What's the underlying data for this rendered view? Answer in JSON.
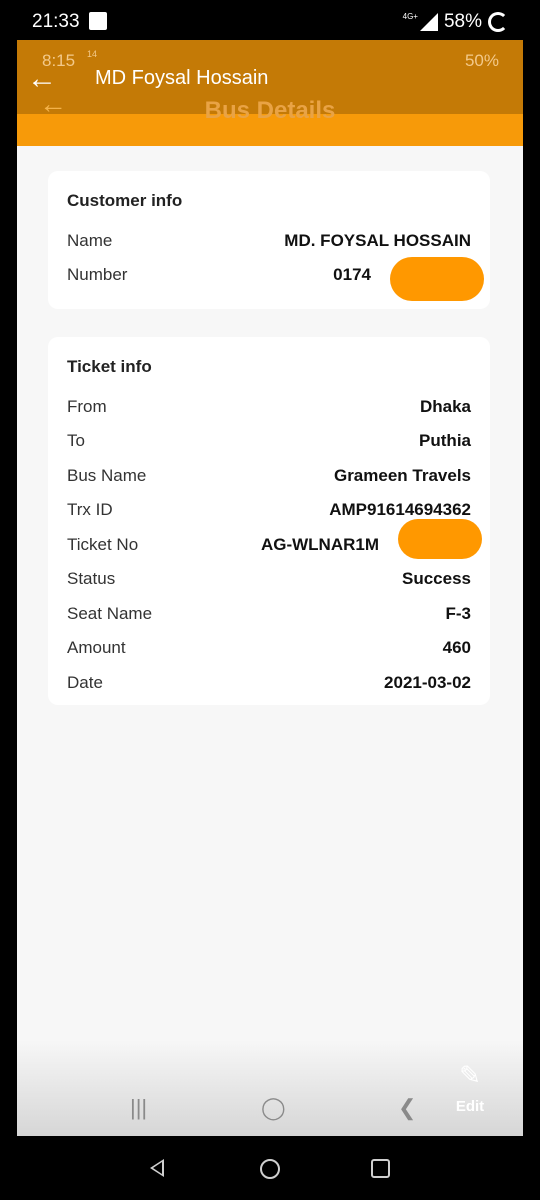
{
  "outer_status": {
    "time": "21:33",
    "network": "4G+",
    "battery": "58%"
  },
  "inner_status": {
    "time": "8:15",
    "tiny": "14",
    "battery": "50%"
  },
  "chat": {
    "contact_name": "MD Foysal Hossain"
  },
  "app": {
    "title": "Bus Details"
  },
  "customer": {
    "title": "Customer info",
    "rows": [
      {
        "label": "Name",
        "value": "MD. FOYSAL HOSSAIN"
      },
      {
        "label": "Number",
        "value": "0174"
      }
    ]
  },
  "ticket": {
    "title": "Ticket info",
    "rows": [
      {
        "label": "From",
        "value": "Dhaka"
      },
      {
        "label": "To",
        "value": "Puthia"
      },
      {
        "label": "Bus Name",
        "value": "Grameen Travels"
      },
      {
        "label": "Trx ID",
        "value": "AMP91614694362"
      },
      {
        "label": "Ticket No",
        "value": "AG-WLNAR1M"
      },
      {
        "label": "Status",
        "value": "Success"
      },
      {
        "label": "Seat Name",
        "value": "F-3"
      },
      {
        "label": "Amount",
        "value": "460"
      },
      {
        "label": "Date",
        "value": "2021-03-02"
      }
    ]
  },
  "edit": {
    "label": "Edit",
    "icon": "pencil-icon"
  },
  "colors": {
    "header": "#f79a09",
    "status_bar": "#c47a06",
    "redaction": "#ff9800"
  }
}
